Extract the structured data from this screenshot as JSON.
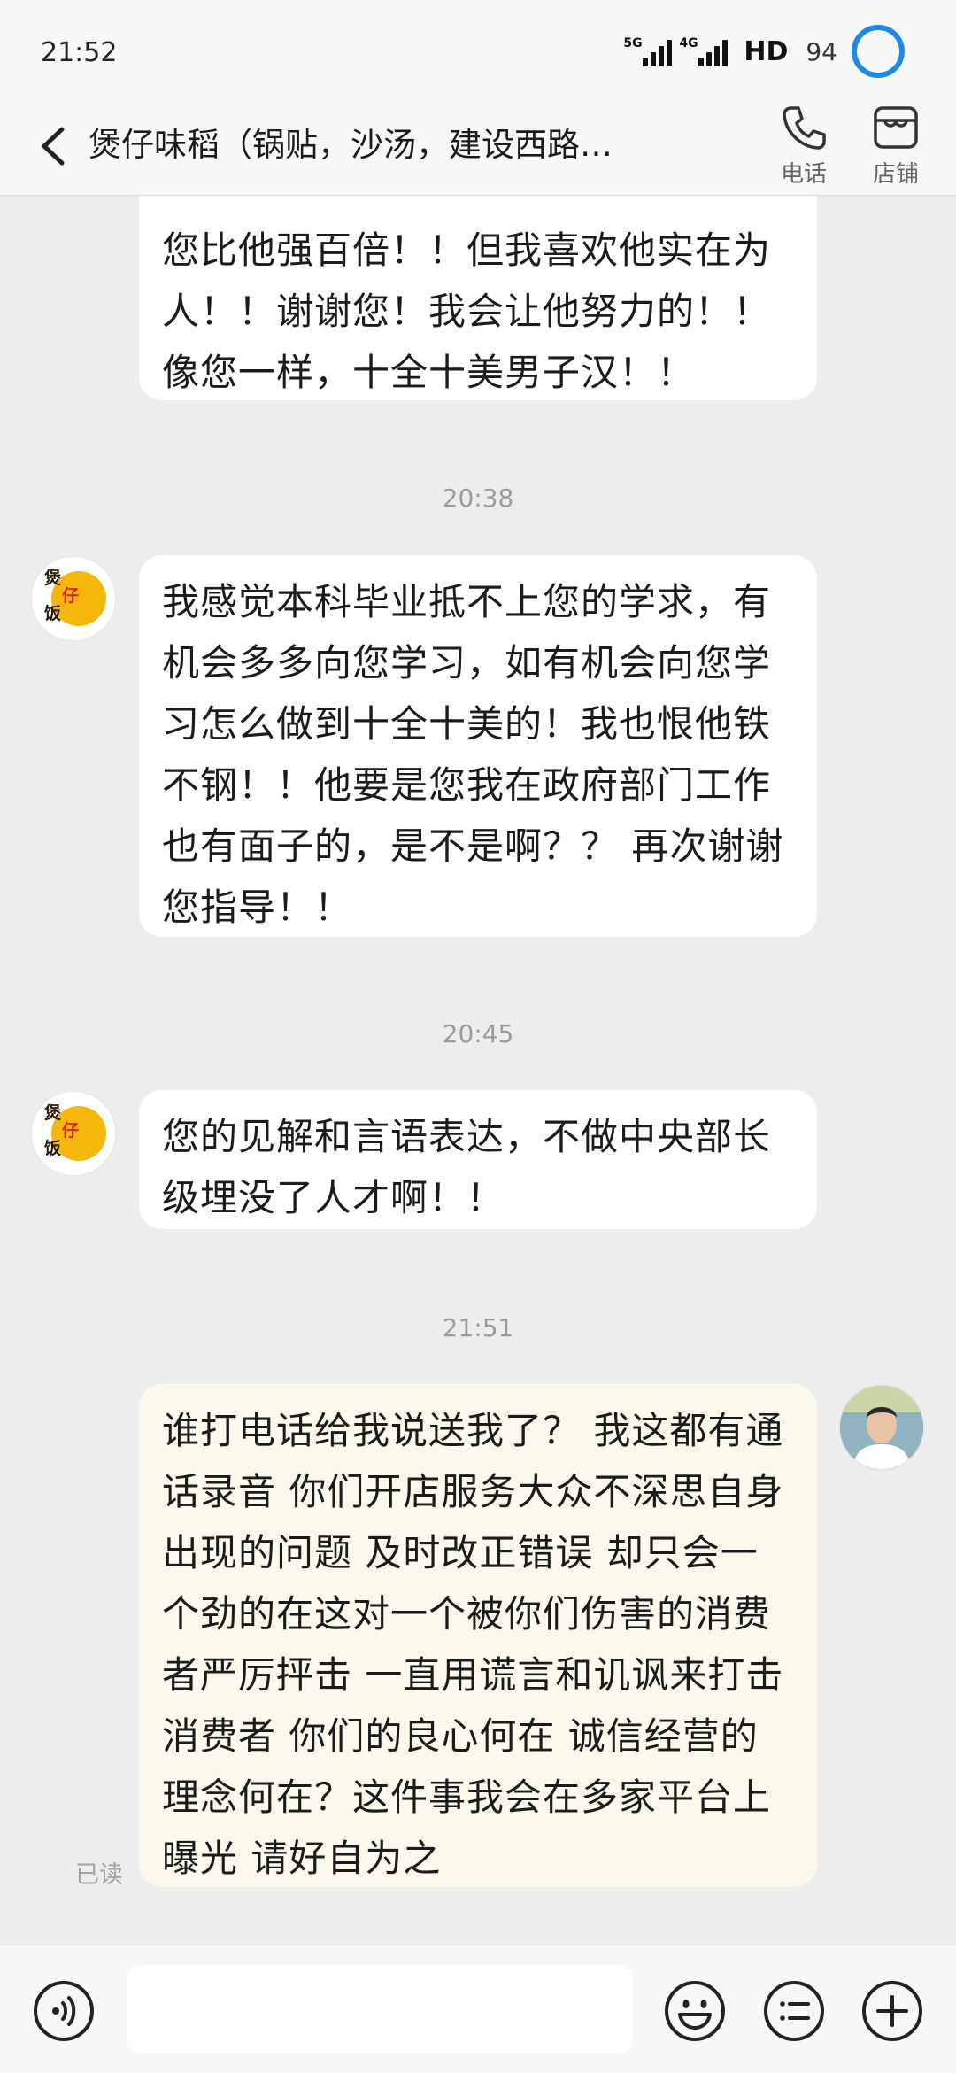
{
  "status": {
    "time": "21:52",
    "net1": "5G",
    "net2": "4G",
    "hd": "HD",
    "battery": "94"
  },
  "header": {
    "title": "煲仔味稻（锅贴，沙汤，建设西路…",
    "phone_label": "电话",
    "store_label": "店铺"
  },
  "chat": {
    "msg0": {
      "text": "您比他强百倍！！但我喜欢他实在为人！！谢谢您！我会让他努力的！！像您一样，十全十美男子汉！！"
    },
    "time1": "20:38",
    "msg1": {
      "text": "我感觉本科毕业抵不上您的学求，有机会多多向您学习，如有机会向您学习怎么做到十全十美的！我也恨他铁不钢！！他要是您我在政府部门工作也有面子的，是不是啊？？ 再次谢谢您指导！！"
    },
    "time2": "20:45",
    "msg2": {
      "text": "您的见解和言语表达，不做中央部长级埋没了人才啊！！"
    },
    "time3": "21:51",
    "msg3": {
      "text": "谁打电话给我说送我了？ 我这都有通话录音  你们开店服务大众不深思自身出现的问题 及时改正错误 却只会一个劲的在这对一个被你们伤害的消费者严厉抨击 一直用谎言和讥讽来打击消费者 你们的良心何在 诚信经营的理念何在？这件事我会在多家平台上曝光 请好自为之"
    },
    "read_label": "已读",
    "shop_avatar_text": [
      "煲",
      "仔",
      "饭"
    ]
  },
  "colors": {
    "mine_bubble": "#fbf8ec",
    "battery_ring": "#1e88e5",
    "avatar_disc": "#f6b70c"
  }
}
